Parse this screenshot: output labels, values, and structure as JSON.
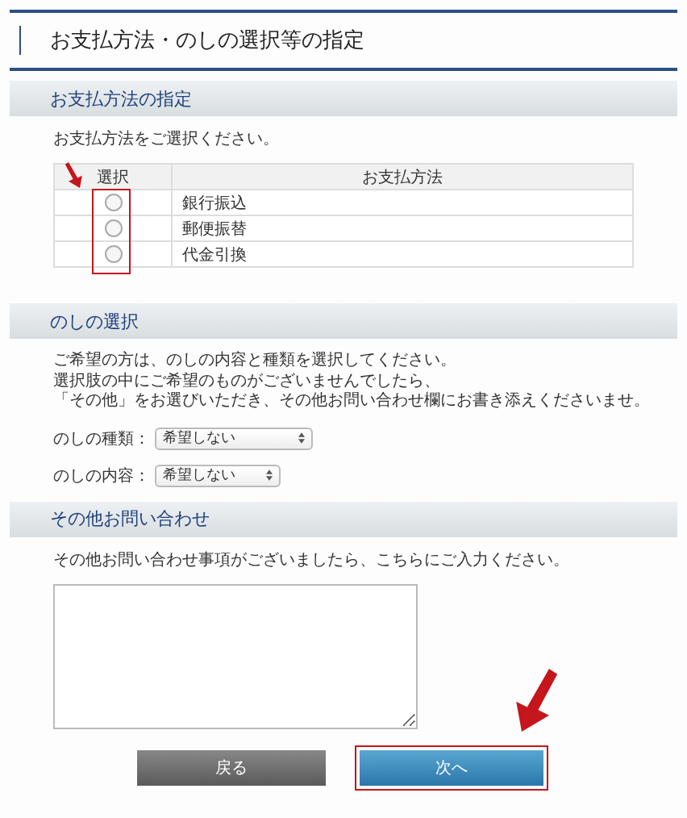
{
  "page_title": "お支払方法・のしの選択等の指定",
  "payment": {
    "heading": "お支払方法の指定",
    "instruction": "お支払方法をご選択ください。",
    "columns": [
      "選択",
      "お支払方法"
    ],
    "rows": [
      {
        "label": "銀行振込",
        "selected": false
      },
      {
        "label": "郵便振替",
        "selected": false
      },
      {
        "label": "代金引換",
        "selected": false
      }
    ]
  },
  "noshi": {
    "heading": "のしの選択",
    "lines": [
      "ご希望の方は、のしの内容と種類を選択してください。",
      "選択肢の中にご希望のものがございませんでしたら、",
      "「その他」をお選びいただき、その他お問い合わせ欄にお書き添えくださいませ。"
    ],
    "fields": [
      {
        "label": "のしの種類：",
        "value": "希望しない"
      },
      {
        "label": "のしの内容：",
        "value": "希望しない"
      }
    ]
  },
  "inquiry": {
    "heading": "その他お問い合わせ",
    "instruction": "その他お問い合わせ事項がございましたら、こちらにご入力ください。"
  },
  "buttons": [
    {
      "label": "戻る",
      "kind": "back"
    },
    {
      "label": "次へ",
      "kind": "next"
    }
  ]
}
